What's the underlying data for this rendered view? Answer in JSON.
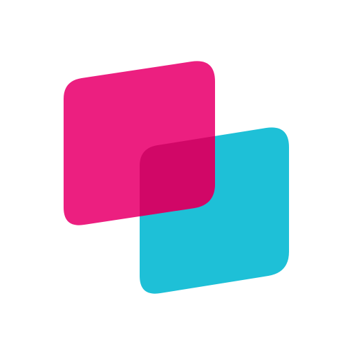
{
  "logo": {
    "colors": {
      "background": "#ffffff",
      "pink": "#ec1f80",
      "cyan": "#1ec0d7",
      "overlap": "#d10767"
    },
    "shapes": [
      "pink-rounded-square",
      "cyan-rounded-square"
    ]
  }
}
